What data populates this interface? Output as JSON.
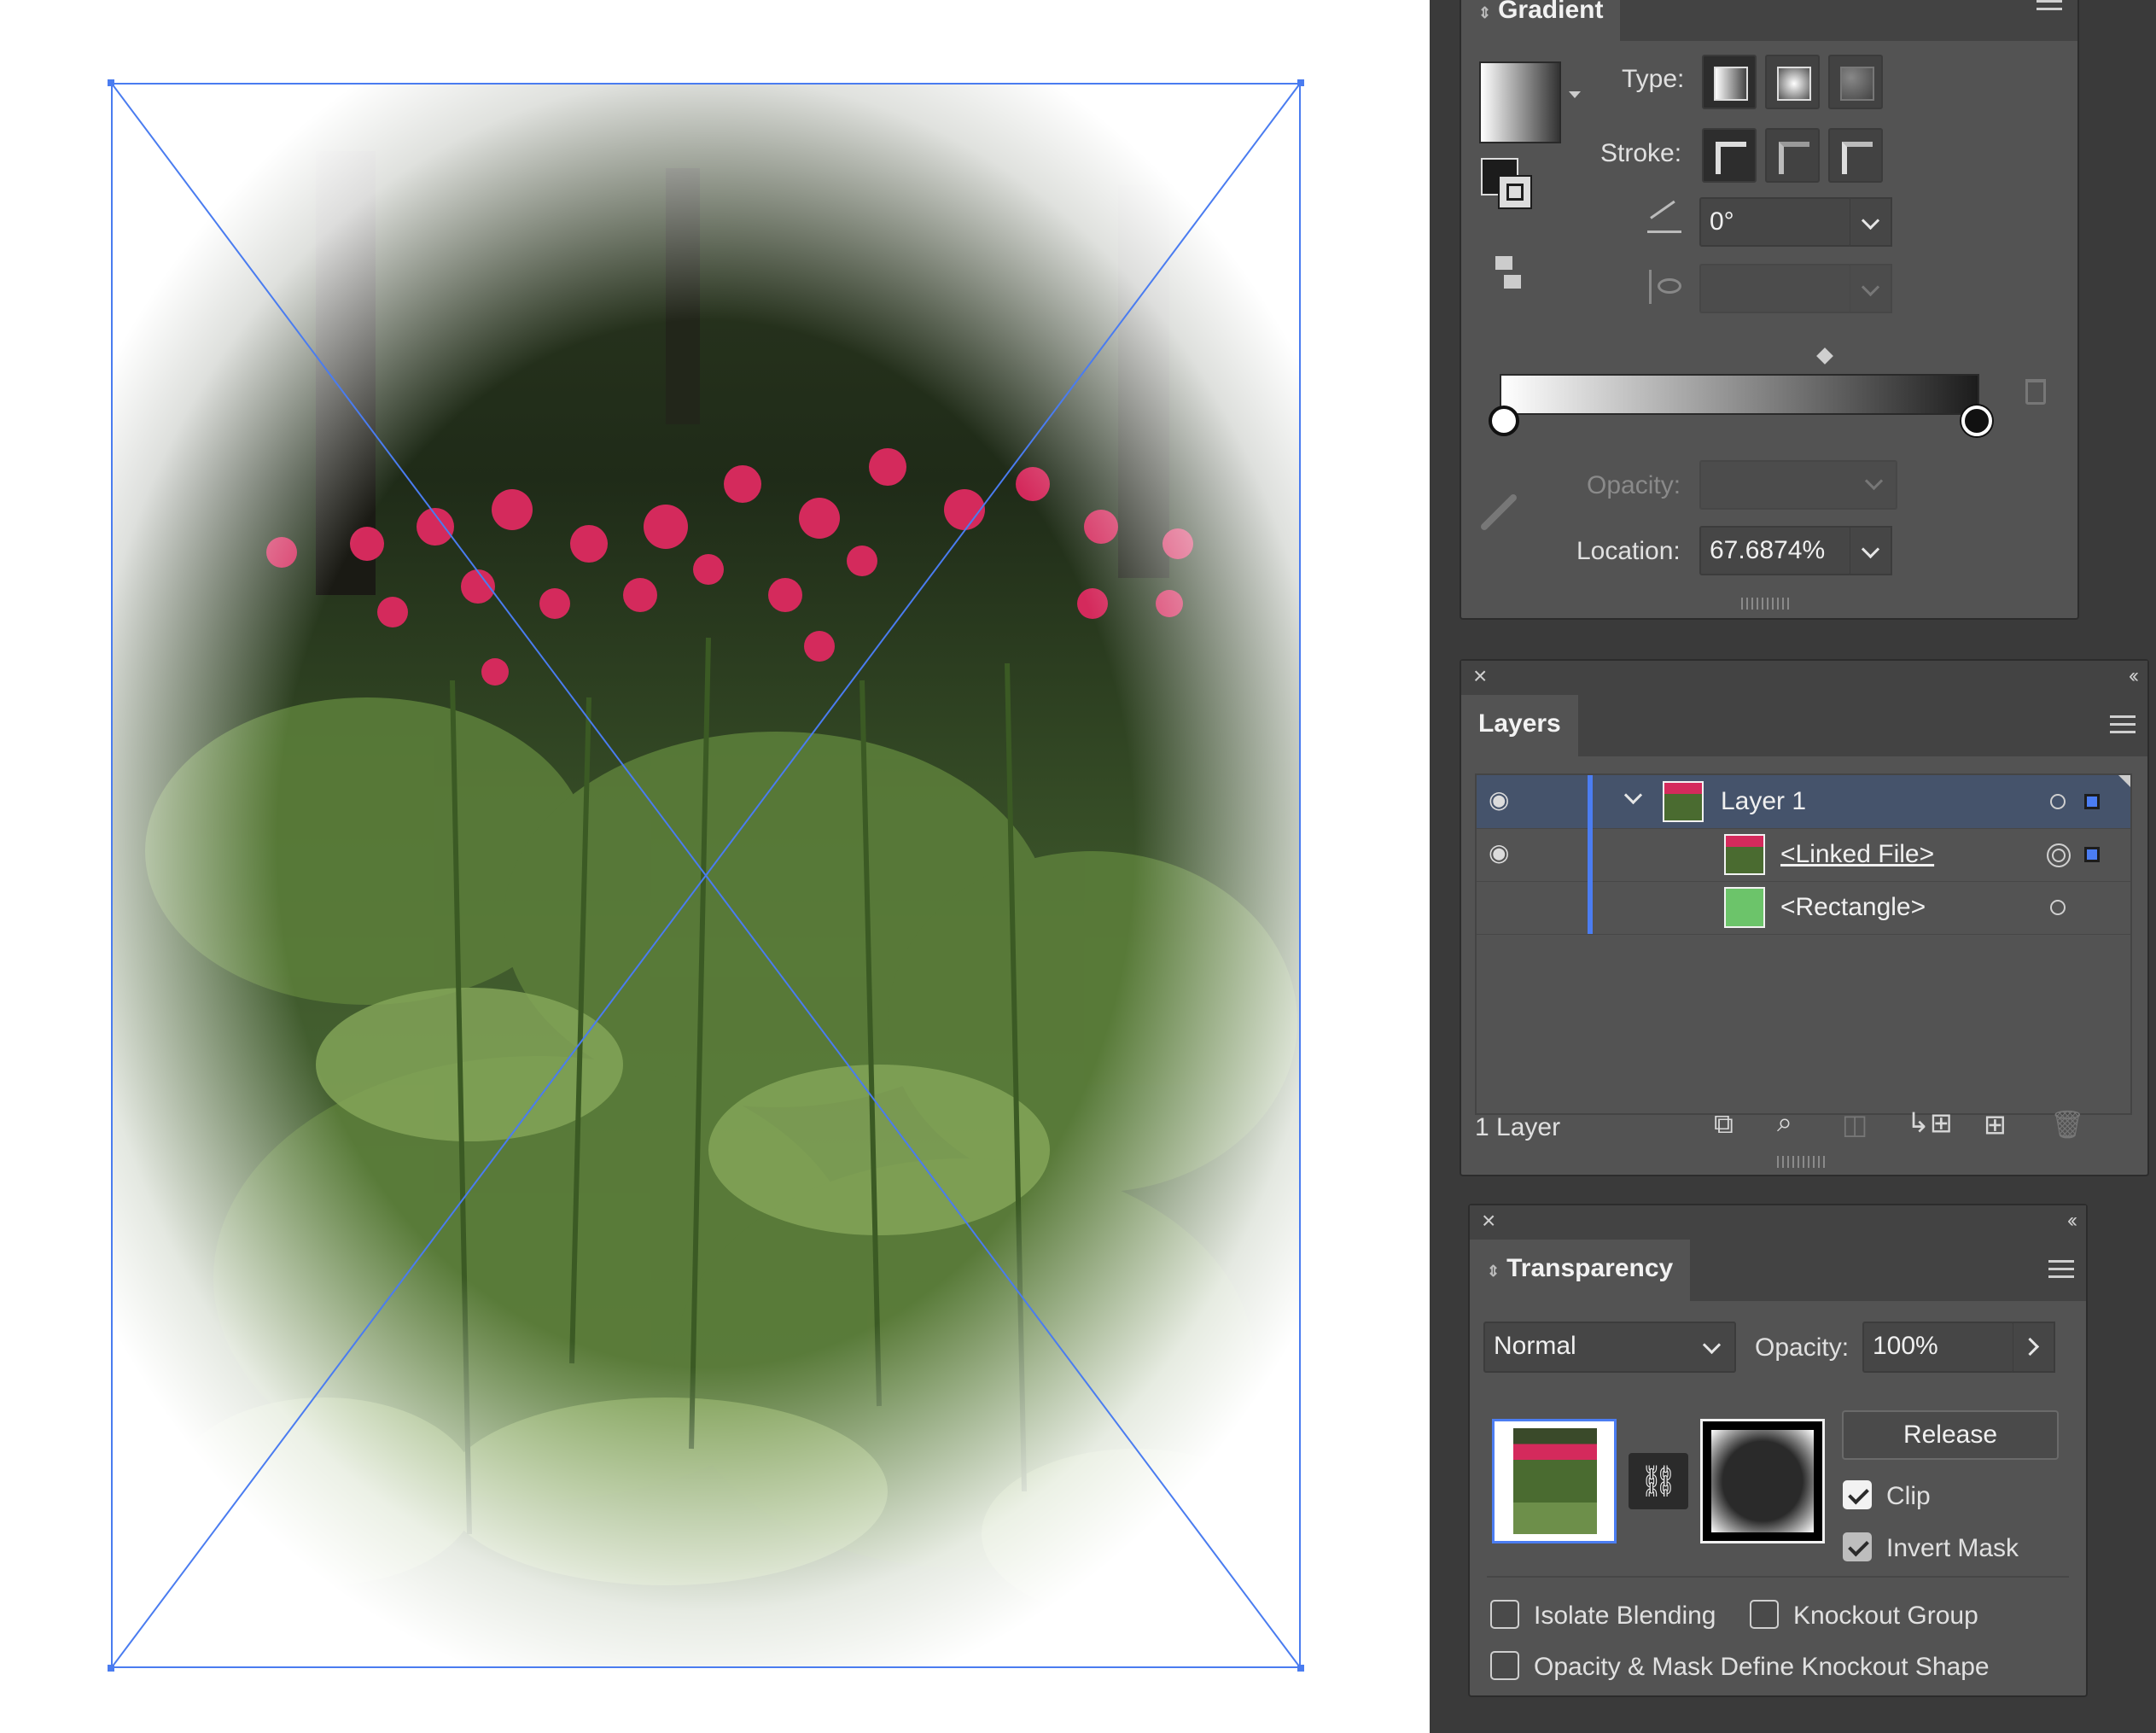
{
  "gradient_panel": {
    "title": "Gradient",
    "type_label": "Type:",
    "stroke_label": "Stroke:",
    "angle_value": "0°",
    "opacity_label": "Opacity:",
    "location_label": "Location:",
    "location_value": "67.6874%",
    "icons": [
      "gradient-swatch-icon",
      "fill-stroke-icon",
      "linear-type-icon",
      "radial-type-icon",
      "freeform-type-icon",
      "stroke-within-icon",
      "stroke-along-icon",
      "stroke-across-icon",
      "angle-icon",
      "aspect-ratio-icon",
      "delete-stop-icon",
      "eyedropper-icon",
      "reverse-gradient-icon",
      "panel-menu-icon"
    ]
  },
  "layers_panel": {
    "title": "Layers",
    "rows": [
      {
        "name": "Layer 1",
        "visible": true,
        "selected": true,
        "expanded": true,
        "thumb": "photo"
      },
      {
        "name": "<Linked File>",
        "visible": true,
        "selected": false,
        "thumb": "photo"
      },
      {
        "name": "<Rectangle>",
        "visible": false,
        "selected": false,
        "thumb": "green"
      }
    ],
    "footer_count": "1 Layer",
    "footer_icons": [
      "export-icon",
      "locate-object-icon",
      "make-clipping-mask-icon",
      "create-sublayer-icon",
      "new-layer-icon",
      "delete-layer-icon"
    ]
  },
  "transparency_panel": {
    "title": "Transparency",
    "blend_mode": "Normal",
    "opacity_label": "Opacity:",
    "opacity_value": "100%",
    "release_label": "Release",
    "clip_label": "Clip",
    "clip_checked": true,
    "invert_mask_label": "Invert Mask",
    "invert_mask_checked": true,
    "isolate_blending_label": "Isolate Blending",
    "isolate_blending_checked": false,
    "knockout_group_label": "Knockout Group",
    "knockout_group_checked": false,
    "opacity_mask_knockout_label": "Opacity & Mask Define Knockout Shape",
    "opacity_mask_knockout_checked": false
  },
  "colors": {
    "selection": "#4a7cf0",
    "panel_bg": "#535353",
    "dock_bg": "#3a3a3a",
    "layer_color": "#4b7df2",
    "rectangle_fill": "#6cc46a"
  }
}
